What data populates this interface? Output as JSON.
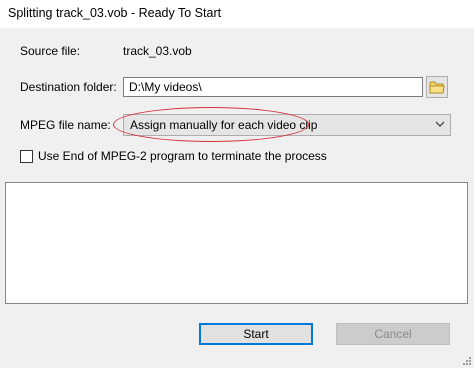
{
  "window": {
    "title": "Splitting track_03.vob - Ready To Start"
  },
  "source": {
    "label": "Source file:",
    "value": "track_03.vob"
  },
  "destination": {
    "label": "Destination folder:",
    "value": "D:\\My videos\\",
    "browse_icon": "folder-icon"
  },
  "mpeg": {
    "label": "MPEG file name:",
    "selected": "Assign manually for each video clip",
    "annotation_color": "#d6303a"
  },
  "option": {
    "label": "Use End of MPEG-2 program to terminate the process",
    "checked": false
  },
  "log": {
    "text": ""
  },
  "buttons": {
    "start": "Start",
    "cancel": "Cancel"
  }
}
